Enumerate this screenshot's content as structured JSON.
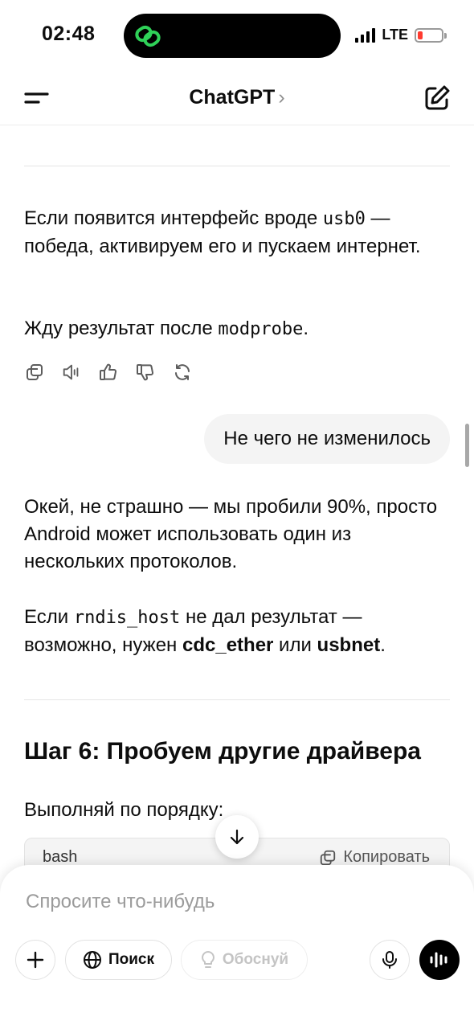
{
  "status_bar": {
    "time": "02:48",
    "network": "LTE"
  },
  "header": {
    "title": "ChatGPT",
    "title_chevron": "›"
  },
  "messages": {
    "assistant_1": {
      "p1_text": "Если появится интерфейс вроде ",
      "p1_code": "usb0",
      "p1_rest": " — победа, активируем его и пускаем интернет.",
      "p2_text": "Жду результат после ",
      "p2_code": "modprobe",
      "p2_end": "."
    },
    "user_1": {
      "text": "Не чего не изменилось"
    },
    "assistant_2": {
      "p1": "Окей, не страшно — мы пробили 90%, просто Android может использовать один из нескольких протоколов.",
      "p2_a": "Если ",
      "p2_code": "rndis_host",
      "p2_b": " не дал результат — возможно, нужен ",
      "p2_bold1": "cdc_ether",
      "p2_c": " или ",
      "p2_bold2": "usbnet",
      "p2_d": ".",
      "heading": "Шаг 6: Пробуем другие драйвера",
      "p3": "Выполняй по порядку:",
      "code_lang": "bash",
      "copy_label": "Копировать"
    }
  },
  "composer": {
    "placeholder": "Спросите что-нибудь",
    "search_label": "Поиск",
    "think_label": "Обоснуй"
  },
  "icons": {
    "island": "chatgpt-link-icon",
    "actions": [
      "copy-icon",
      "speaker-icon",
      "thumbs-up-icon",
      "thumbs-down-icon",
      "regenerate-icon"
    ],
    "accent_green": "#2fd158",
    "battery_red": "#ff3b30"
  }
}
